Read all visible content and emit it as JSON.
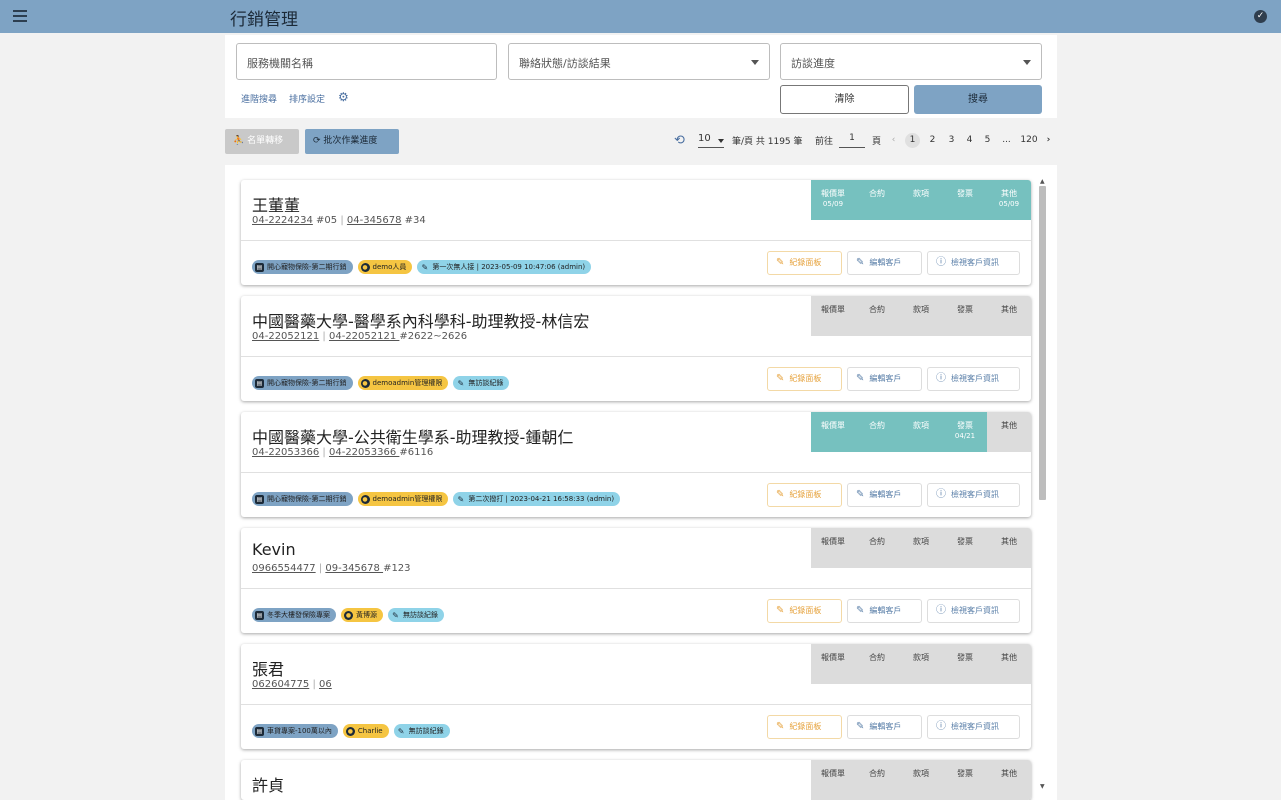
{
  "appbar": {
    "title": "行銷管理"
  },
  "filters": {
    "org_placeholder": "服務機關名稱",
    "contact_status": "聯絡狀態/訪談結果",
    "progress": "訪談進度",
    "advanced_search": "進階搜尋",
    "sort_settings": "排序設定",
    "clear": "清除",
    "search": "搜尋"
  },
  "toolbar": {
    "move_list": "名單轉移",
    "batch_progress": "批次作業進度"
  },
  "pagination": {
    "page_size": "10",
    "per_page_total": "筆/頁 共 1195 筆",
    "goto_label": "前往",
    "current_input": "1",
    "page_suffix": "頁",
    "prev": "‹",
    "pages": [
      "1",
      "2",
      "3",
      "4",
      "5",
      "...",
      "120"
    ],
    "next": "›"
  },
  "status_headers": [
    "報價單",
    "合約",
    "款項",
    "發票",
    "其他"
  ],
  "actions": {
    "record_panel": "紀錄面板",
    "edit_customer": "編輯客戶",
    "view_customer": "檢視客戶資訊"
  },
  "cards": [
    {
      "name": "王董董",
      "phone1": "04-2224234",
      "ext1": " #05",
      "phone2": "04-345678",
      "ext2": " #34",
      "status": [
        {
          "on": true,
          "date": "05/09"
        },
        {
          "on": true,
          "date": ""
        },
        {
          "on": true,
          "date": ""
        },
        {
          "on": true,
          "date": ""
        },
        {
          "on": true,
          "date": "05/09"
        }
      ],
      "project": "開心寵物保險-第二期行銷",
      "user": "demo人員",
      "record": "第一次無人接 | 2023-05-09 10:47:06 (admin)"
    },
    {
      "name": "中國醫藥大學-醫學系內科學科-助理教授-林信宏",
      "phone1": "04-22052121",
      "ext1": "",
      "phone2": "04-22052121 ",
      "ext2": "#2622~2626",
      "status": [
        {
          "on": false,
          "date": ""
        },
        {
          "on": false,
          "date": ""
        },
        {
          "on": false,
          "date": ""
        },
        {
          "on": false,
          "date": ""
        },
        {
          "on": false,
          "date": ""
        }
      ],
      "project": "開心寵物保險-第二期行銷",
      "user": "demoadmin管理權限",
      "record": "無訪談紀錄"
    },
    {
      "name": "中國醫藥大學-公共衛生學系-助理教授-鍾朝仁",
      "phone1": "04-22053366",
      "ext1": "",
      "phone2": "04-22053366 ",
      "ext2": "#6116",
      "status": [
        {
          "on": true,
          "date": ""
        },
        {
          "on": true,
          "date": ""
        },
        {
          "on": true,
          "date": ""
        },
        {
          "on": true,
          "date": "04/21"
        },
        {
          "on": false,
          "date": ""
        }
      ],
      "project": "開心寵物保險-第二期行銷",
      "user": "demoadmin管理權限",
      "record": "第二次撥打 | 2023-04-21 16:58:33 (admin)"
    },
    {
      "name": "Kevin",
      "phone1": "0966554477",
      "ext1": "",
      "phone2": "09-345678 ",
      "ext2": "#123",
      "status": [
        {
          "on": false,
          "date": ""
        },
        {
          "on": false,
          "date": ""
        },
        {
          "on": false,
          "date": ""
        },
        {
          "on": false,
          "date": ""
        },
        {
          "on": false,
          "date": ""
        }
      ],
      "project": "冬季大樓發保險專案",
      "user": "黃博源",
      "record": "無訪談紀錄"
    },
    {
      "name": "張君",
      "phone1": "062604775",
      "ext1": "",
      "phone2": "06",
      "ext2": "",
      "status": [
        {
          "on": false,
          "date": ""
        },
        {
          "on": false,
          "date": ""
        },
        {
          "on": false,
          "date": ""
        },
        {
          "on": false,
          "date": ""
        },
        {
          "on": false,
          "date": ""
        }
      ],
      "project": "車貸專案-100萬以內",
      "user": "Charlie",
      "record": "無訪談紀錄"
    },
    {
      "name": "許貞",
      "phone1": "",
      "ext1": "",
      "phone2": "",
      "ext2": "",
      "status": [
        {
          "on": false,
          "date": ""
        },
        {
          "on": false,
          "date": ""
        },
        {
          "on": false,
          "date": ""
        },
        {
          "on": false,
          "date": ""
        },
        {
          "on": false,
          "date": ""
        }
      ],
      "project": "",
      "user": "",
      "record": ""
    }
  ]
}
